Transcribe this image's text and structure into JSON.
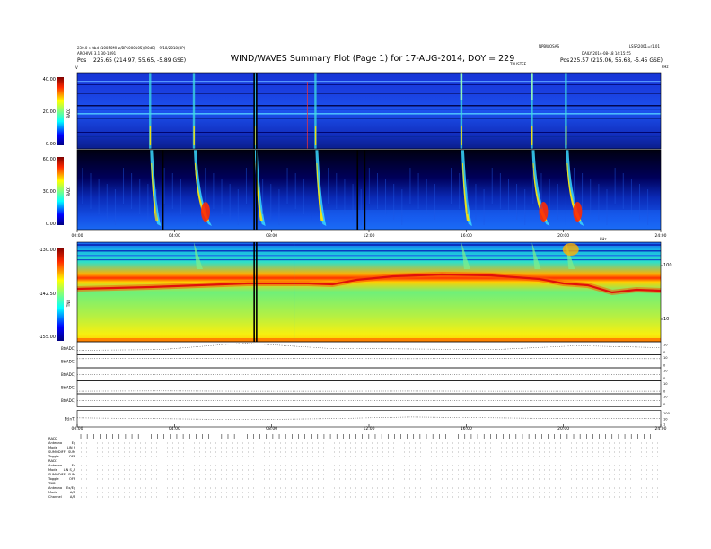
{
  "header": {
    "title": "WIND/WAVES Summary Plot (Page 1) for 17-AUG-2014, DOY = 229",
    "left_line1": "230.0 > tbd (10050MHz/BP1000105)(90dB) - 9/18/2018(BP)",
    "left_line2": "ARCHIVE 3.1 30-1891",
    "left_line3_label": "Pos",
    "left_line3_value": "225.65 (214.97, 55.65, -5.89 GSE)",
    "right_top_left": "NPBWOSAS",
    "right_top_right": "LSSR2001=r1.01",
    "right_line2": "DAILY 2014-08-18 14:15:55",
    "right_line3_label": "Pos",
    "right_line3_value": "225.57 (215.06, 55.68, -5.45 GSE)",
    "marker_left": "V",
    "marker_mid": "TRUSTEE",
    "marker_right": "kHz"
  },
  "chart_data": [
    {
      "type": "heatmap",
      "name": "RAD2",
      "ylabel": "RAD2",
      "yticks": [
        "40.00",
        "20.00",
        "0.00"
      ],
      "ylim": [
        0,
        40
      ],
      "color_scale": "jet"
    },
    {
      "type": "heatmap",
      "name": "RAD1",
      "ylabel": "RAD1",
      "yticks": [
        "60.00",
        "30.00",
        "0.00"
      ],
      "ylim": [
        0,
        60
      ],
      "xticks": [
        "00:00",
        "04:00",
        "08:00",
        "12:00",
        "16:00",
        "20:00",
        "24:00"
      ],
      "xlim": [
        0,
        24
      ],
      "bursts_hours": [
        3.0,
        4.8,
        7.3,
        9.8,
        15.8,
        18.7,
        20.1
      ],
      "color_scale": "jet"
    },
    {
      "type": "heatmap",
      "name": "TNR",
      "ylabel": "TNR",
      "yticks": [
        "-130.00",
        "-142.50",
        "-155.00"
      ],
      "ylim": [
        -155,
        -130
      ],
      "right_axis_label": "kHz",
      "right_ticks": [
        "100",
        "10"
      ],
      "color_scale": "jet"
    },
    {
      "type": "line",
      "name": "housekeeping",
      "rows": [
        {
          "label": "Bt(ADC)",
          "ticks": [
            "10",
            "0"
          ],
          "values": [
            0.35,
            0.4,
            0.9,
            0.5,
            0.45,
            0.4,
            0.7,
            0.55
          ]
        },
        {
          "label": "Bt(ADC)",
          "ticks": [
            "10",
            "0"
          ],
          "values": [
            0.7,
            0.72,
            0.7,
            0.71,
            0.7,
            0.72,
            0.71,
            0.7
          ]
        },
        {
          "label": "Bt(ADC)",
          "ticks": [
            "10",
            "0"
          ],
          "values": [
            0.5,
            0.5,
            0.5,
            0.5,
            0.5,
            0.5,
            0.5,
            0.5
          ]
        },
        {
          "label": "Bt(ADC)",
          "ticks": [
            "10",
            "0"
          ],
          "values": [
            0.2,
            0.22,
            0.2,
            0.2,
            0.21,
            0.2,
            0.2,
            0.2
          ]
        },
        {
          "label": "Bt(ADC)",
          "ticks": [
            "10",
            "0"
          ],
          "values": [
            0.5,
            0.5,
            0.5,
            0.5,
            0.5,
            0.5,
            0.5,
            0.5
          ]
        },
        {
          "label": "Bt(nT)",
          "ticks": [
            "100",
            "10",
            "1"
          ],
          "values": [
            0.55,
            0.5,
            0.45,
            0.5,
            0.6,
            0.55,
            0.5,
            0.52
          ]
        }
      ],
      "xticks": [
        "00:00",
        "04:00",
        "08:00",
        "12:00",
        "16:00",
        "20:00",
        "24:00"
      ]
    }
  ],
  "status": {
    "rad2_header": "RAD2",
    "rad2_rows": [
      {
        "k": "Antenna",
        "v": "Ey"
      },
      {
        "k": "Mode",
        "v": "LIN S"
      },
      {
        "k": "SUMODIFF",
        "v": "SUM"
      },
      {
        "k": "Toggle",
        "v": "OFF"
      }
    ],
    "rad1_header": "RAD1",
    "rad1_rows": [
      {
        "k": "Antenna",
        "v": "Ex"
      },
      {
        "k": "Mode",
        "v": "LIN S_A"
      },
      {
        "k": "SUMODIFF",
        "v": "SUM"
      },
      {
        "k": "Toggle",
        "v": "OFF"
      }
    ],
    "tnr_header": "TNR",
    "tnr_rows": [
      {
        "k": "Antenna",
        "v": "Ex/Ey"
      },
      {
        "k": "Mode",
        "v": "A/B"
      },
      {
        "k": "Channel",
        "v": "A/B"
      }
    ]
  },
  "colors": {
    "background": "#ffffff",
    "axis": "#000000",
    "grid_dots": "#000000"
  }
}
